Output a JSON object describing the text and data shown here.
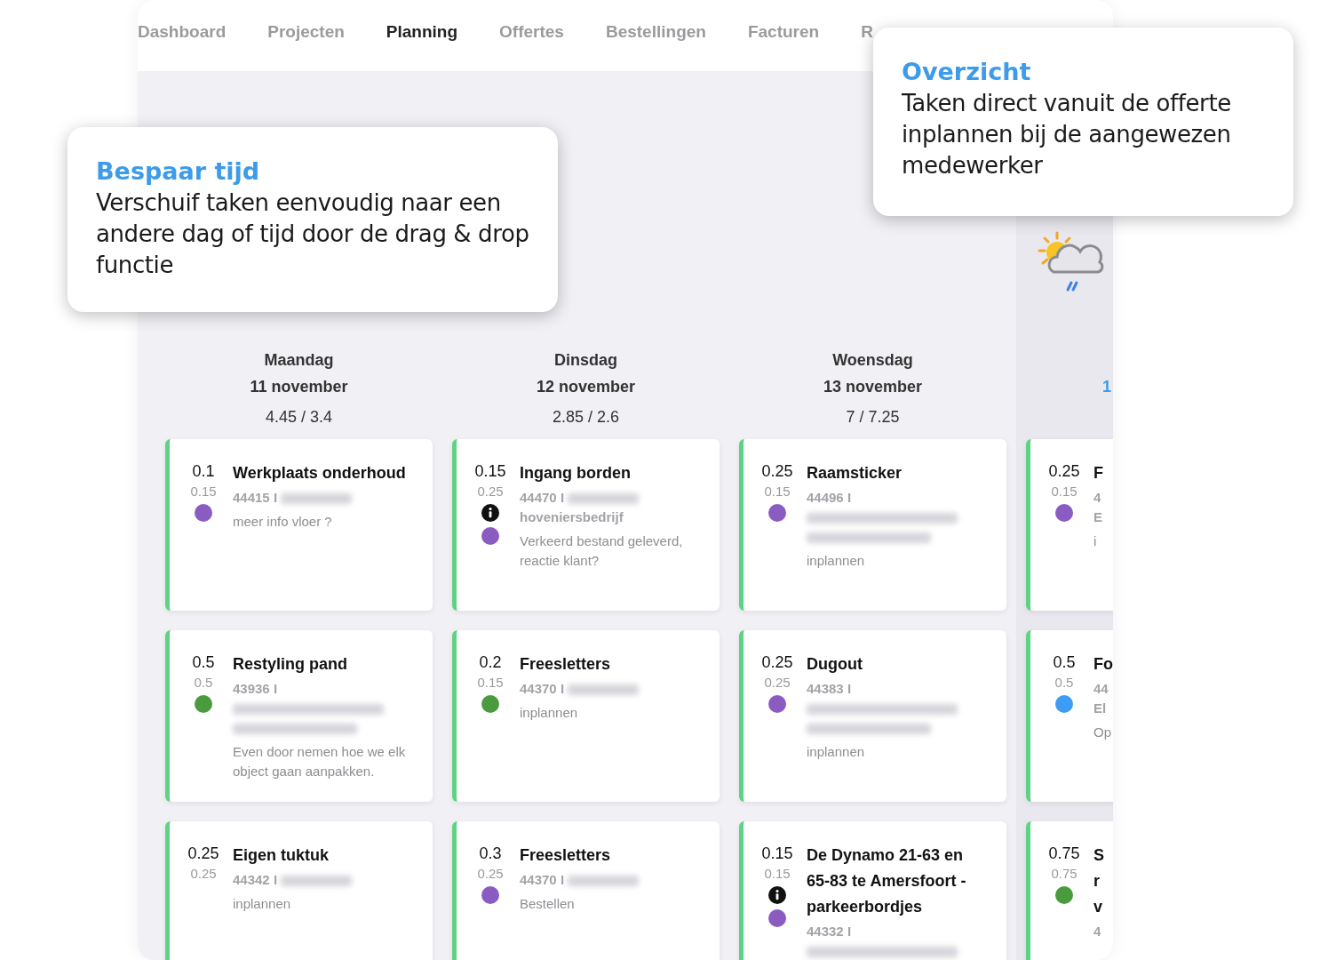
{
  "nav": [
    {
      "label": "Dashboard",
      "selected": false
    },
    {
      "label": "Projecten",
      "selected": false
    },
    {
      "label": "Planning",
      "selected": true
    },
    {
      "label": "Offertes",
      "selected": false
    },
    {
      "label": "Bestellingen",
      "selected": false
    },
    {
      "label": "Facturen",
      "selected": false
    },
    {
      "label": "R",
      "selected": false
    }
  ],
  "callouts": [
    {
      "title": "Bespaar tijd",
      "body": "Verschuif taken eenvoudig naar een andere dag of tijd door de drag & drop functie"
    },
    {
      "title": "Overzicht",
      "body": "Taken direct vanuit de offerte inplannen bij de aangewezen medewerker"
    }
  ],
  "days": [
    {
      "weekday": "Maandag",
      "date": "11 november",
      "hours": "4.45 / 3.4",
      "today": false,
      "cut": false,
      "tasks": [
        {
          "hours": "0.1",
          "planned": "0.15",
          "info": false,
          "color": "#8a5cc2",
          "title": "Werkplaats onderhoud",
          "ref": "44415 I",
          "blur_wraps": false,
          "note": "meer info vloer ?"
        },
        {
          "hours": "0.5",
          "planned": "0.5",
          "info": false,
          "color": "#4a9a3e",
          "title": "Restyling pand",
          "ref": "43936 I",
          "blur_wraps": true,
          "note": "Even door nemen hoe we elk object gaan aanpakken."
        },
        {
          "hours": "0.25",
          "planned": "0.25",
          "info": false,
          "title": "Eigen tuktuk",
          "ref": "44342 I",
          "blur_wraps": false,
          "note": "inplannen"
        }
      ]
    },
    {
      "weekday": "Dinsdag",
      "date": "12 november",
      "hours": "2.85 / 2.6",
      "today": false,
      "cut": false,
      "tasks": [
        {
          "hours": "0.15",
          "planned": "0.25",
          "info": true,
          "color": "#8a5cc2",
          "title": "Ingang borden",
          "ref": "44470 I",
          "client": "hoveniersbedrijf",
          "blur_wraps": false,
          "note": "Verkeerd bestand geleverd, reactie klant?"
        },
        {
          "hours": "0.2",
          "planned": "0.15",
          "info": false,
          "color": "#4a9a3e",
          "title": "Freesletters",
          "ref": "44370 I",
          "blur_wraps": false,
          "note": "inplannen"
        },
        {
          "hours": "0.3",
          "planned": "0.25",
          "info": false,
          "color": "#8a5cc2",
          "title": "Freesletters",
          "ref": "44370 I",
          "blur_wraps": false,
          "note": "Bestellen"
        }
      ]
    },
    {
      "weekday": "Woensdag",
      "date": "13 november",
      "hours": "7 / 7.25",
      "today": false,
      "cut": false,
      "tasks": [
        {
          "hours": "0.25",
          "planned": "0.15",
          "info": false,
          "color": "#8a5cc2",
          "title": "Raamsticker",
          "ref": "44496 I",
          "blur_wraps": true,
          "note": "inplannen"
        },
        {
          "hours": "0.25",
          "planned": "0.25",
          "info": false,
          "color": "#8a5cc2",
          "title": "Dugout",
          "ref": "44383 I",
          "blur_wraps": true,
          "note": "inplannen"
        },
        {
          "hours": "0.15",
          "planned": "0.15",
          "info": true,
          "color": "#8a5cc2",
          "title": "De Dynamo 21-63 en 65-83 te Amersfoort - parkeerbordjes",
          "ref": "44332 I",
          "blur_wraps": true
        }
      ]
    },
    {
      "date": "1",
      "today": true,
      "cut": true,
      "tasks": [
        {
          "hours": "0.25",
          "planned": "0.15",
          "info": false,
          "color": "#8a5cc2",
          "title": "F",
          "ref": "4",
          "client": "E",
          "blur_wraps": false,
          "note": "i"
        },
        {
          "hours": "0.5",
          "planned": "0.5",
          "info": false,
          "color": "#3d9df5",
          "title": "Fo",
          "ref": "44",
          "client": "El",
          "blur_wraps": false,
          "note": "Op"
        },
        {
          "hours": "0.75",
          "planned": "0.75",
          "info": false,
          "color": "#4a9a3e",
          "title": "S\nr\nv",
          "ref": "4",
          "blur_wraps": false
        }
      ]
    }
  ]
}
